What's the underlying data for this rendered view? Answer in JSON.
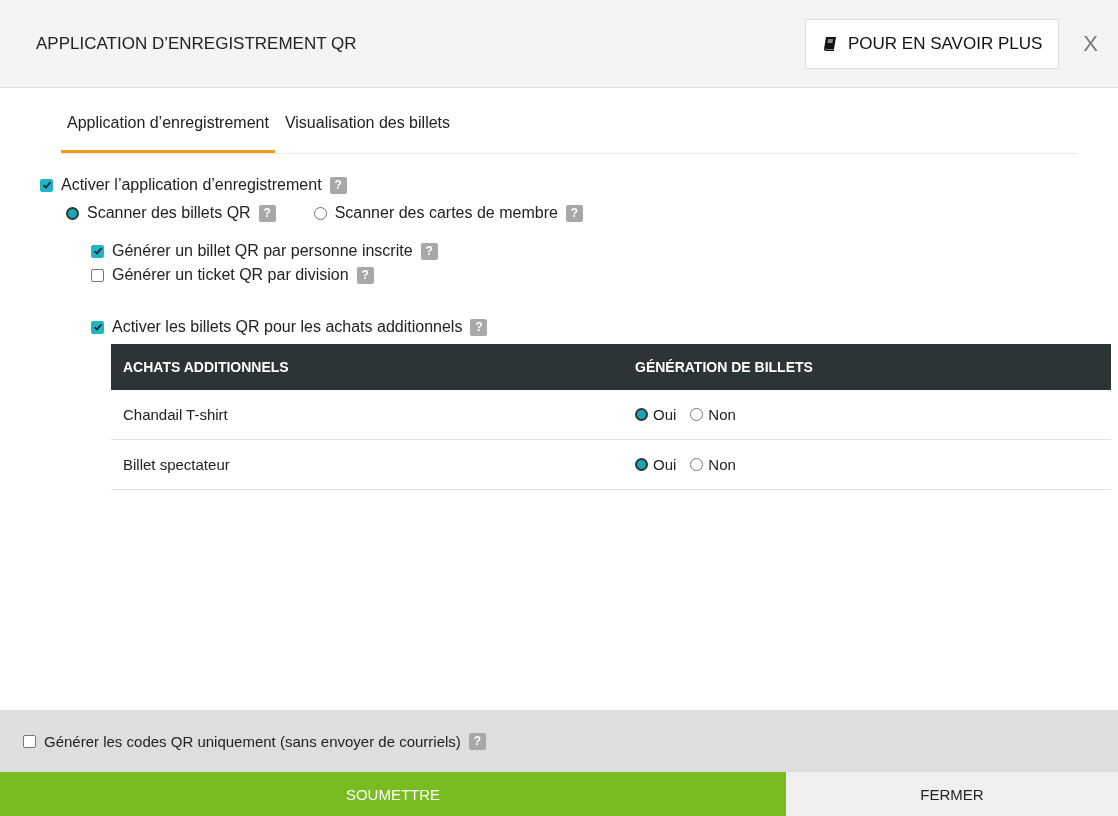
{
  "header": {
    "title": "APPLICATION D’ENREGISTREMENT QR",
    "learn_more": "POUR EN SAVOIR PLUS",
    "close": "X"
  },
  "tabs": [
    {
      "label": "Application d’enregistrement",
      "selected": true
    },
    {
      "label": "Visualisation des billets",
      "selected": false
    }
  ],
  "enable_app": {
    "label": "Activer l’application d’enregistrement",
    "checked": true,
    "help": "?"
  },
  "scan_modes": [
    {
      "label": "Scanner des billets QR",
      "selected": true,
      "help": "?"
    },
    {
      "label": "Scanner des cartes de membre",
      "selected": false,
      "help": "?"
    }
  ],
  "ticket_options": [
    {
      "label": "Générer un billet QR par personne inscrite",
      "checked": true,
      "help": "?"
    },
    {
      "label": "Générer un ticket QR par division",
      "checked": false,
      "help": "?"
    }
  ],
  "addons_toggle": {
    "label": "Activer les billets QR pour les achats additionnels",
    "checked": true,
    "help": "?"
  },
  "table": {
    "columns": [
      "ACHATS ADDITIONNELS",
      "GÉNÉRATION DE BILLETS"
    ],
    "rows": [
      {
        "name": "Chandail T-shirt",
        "options": [
          {
            "label": "Oui",
            "selected": true
          },
          {
            "label": "Non",
            "selected": false
          }
        ]
      },
      {
        "name": "Billet spectateur",
        "options": [
          {
            "label": "Oui",
            "selected": true
          },
          {
            "label": "Non",
            "selected": false
          }
        ]
      }
    ]
  },
  "footer": {
    "qr_only": {
      "label": "Générer les codes QR uniquement (sans envoyer de courriels)",
      "checked": false,
      "help": "?"
    },
    "submit": "SOUMETTRE",
    "close": "FERMER"
  }
}
